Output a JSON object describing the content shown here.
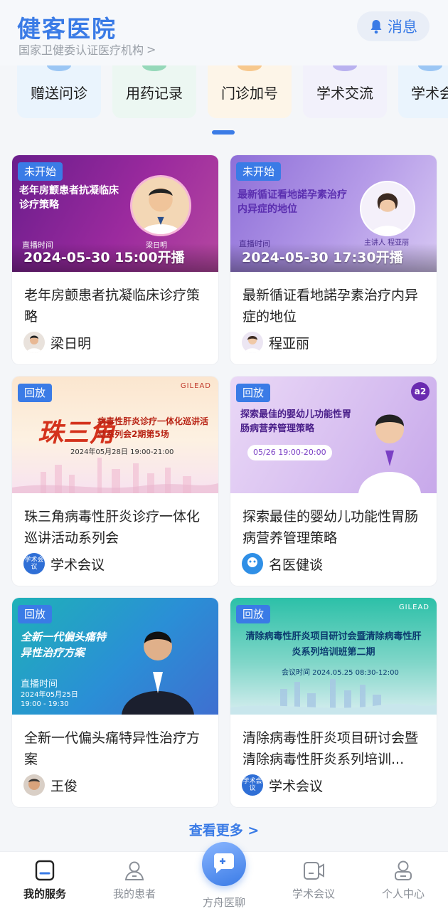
{
  "header": {
    "brand": "健客医院",
    "subtitle": "国家卫健委认证医疗机构",
    "subtitle_chevron": ">",
    "message_label": "消息",
    "accent": "#3a7be6"
  },
  "quick_nav": {
    "items": [
      {
        "label": "赠送问诊",
        "bg": "#eaf4fd",
        "bump": "#5aa0ec"
      },
      {
        "label": "用药记录",
        "bg": "#ecf7f2",
        "bump": "#4ec08a"
      },
      {
        "label": "门诊加号",
        "bg": "#fdf5e8",
        "bump": "#f2a341"
      },
      {
        "label": "学术交流",
        "bg": "#f2f1fb",
        "bump": "#8a7be6"
      },
      {
        "label": "学术会",
        "bg": "#eaf4fd",
        "bump": "#5aa0ec"
      }
    ]
  },
  "cards": [
    {
      "status": "未开始",
      "banner_title": "老年房颤患者抗凝临床诊疗策略",
      "banner_time": "2024-05-30 15:00开播",
      "banner_sub": "直播时间",
      "speaker_banner": "梁日明",
      "title": "老年房颤患者抗凝临床诊疗策略",
      "author": "梁日明"
    },
    {
      "status": "未开始",
      "banner_title": "最新循证看地諾孕素治疗内异症的地位",
      "banner_time": "2024-05-30 17:30开播",
      "banner_sub": "直播时间",
      "speaker_banner": "主讲人 程亚丽",
      "title": "最新循证看地諾孕素治疗内异症的地位",
      "author": "程亚丽"
    },
    {
      "status": "回放",
      "banner_title": "珠三角",
      "banner_title2": "病毒性肝炎诊疗一体化巡讲活动系列会2期第5场",
      "banner_date": "2024年05月28日  19:00-21:00",
      "brand_tag": "GILEAD",
      "title": "珠三角病毒性肝炎诊疗一体化巡讲活动系列会",
      "author": "学术会议",
      "author_avatar_text": "学术会议"
    },
    {
      "status": "回放",
      "banner_title": "探索最佳的婴幼儿功能性胃肠病营养管理策略",
      "banner_date": "05/26  19:00-20:00",
      "brand_tag": "a2",
      "title": "探索最佳的婴幼儿功能性胃肠病营养管理策略",
      "author": "名医健谈"
    },
    {
      "status": "回放",
      "banner_title": "全新一代偏头痛特异性治疗方案",
      "banner_sub": "直播时间",
      "banner_date": "2024年05月25日 19:00 - 19:30",
      "title": "全新一代偏头痛特异性治疗方案",
      "author": "王俊"
    },
    {
      "status": "回放",
      "banner_title": "清除病毒性肝炎项目研讨会暨清除病毒性肝炎系列培训班第二期",
      "banner_date": "会议时间  2024.05.25  08:30-12:00",
      "brand_tag": "GILEAD",
      "title": "清除病毒性肝炎项目研讨会暨清除病毒性肝炎系列培训...",
      "author": "学术会议",
      "author_avatar_text": "学术会议"
    }
  ],
  "see_more": "查看更多 >",
  "tabbar": {
    "items": [
      {
        "label": "我的服务",
        "icon": "home-service-icon",
        "active": true
      },
      {
        "label": "我的患者",
        "icon": "patient-icon",
        "active": false
      },
      {
        "label": "方舟医聊",
        "icon": "chat-icon",
        "active": false
      },
      {
        "label": "学术会议",
        "icon": "video-icon",
        "active": false
      },
      {
        "label": "个人中心",
        "icon": "profile-icon",
        "active": false
      }
    ]
  }
}
